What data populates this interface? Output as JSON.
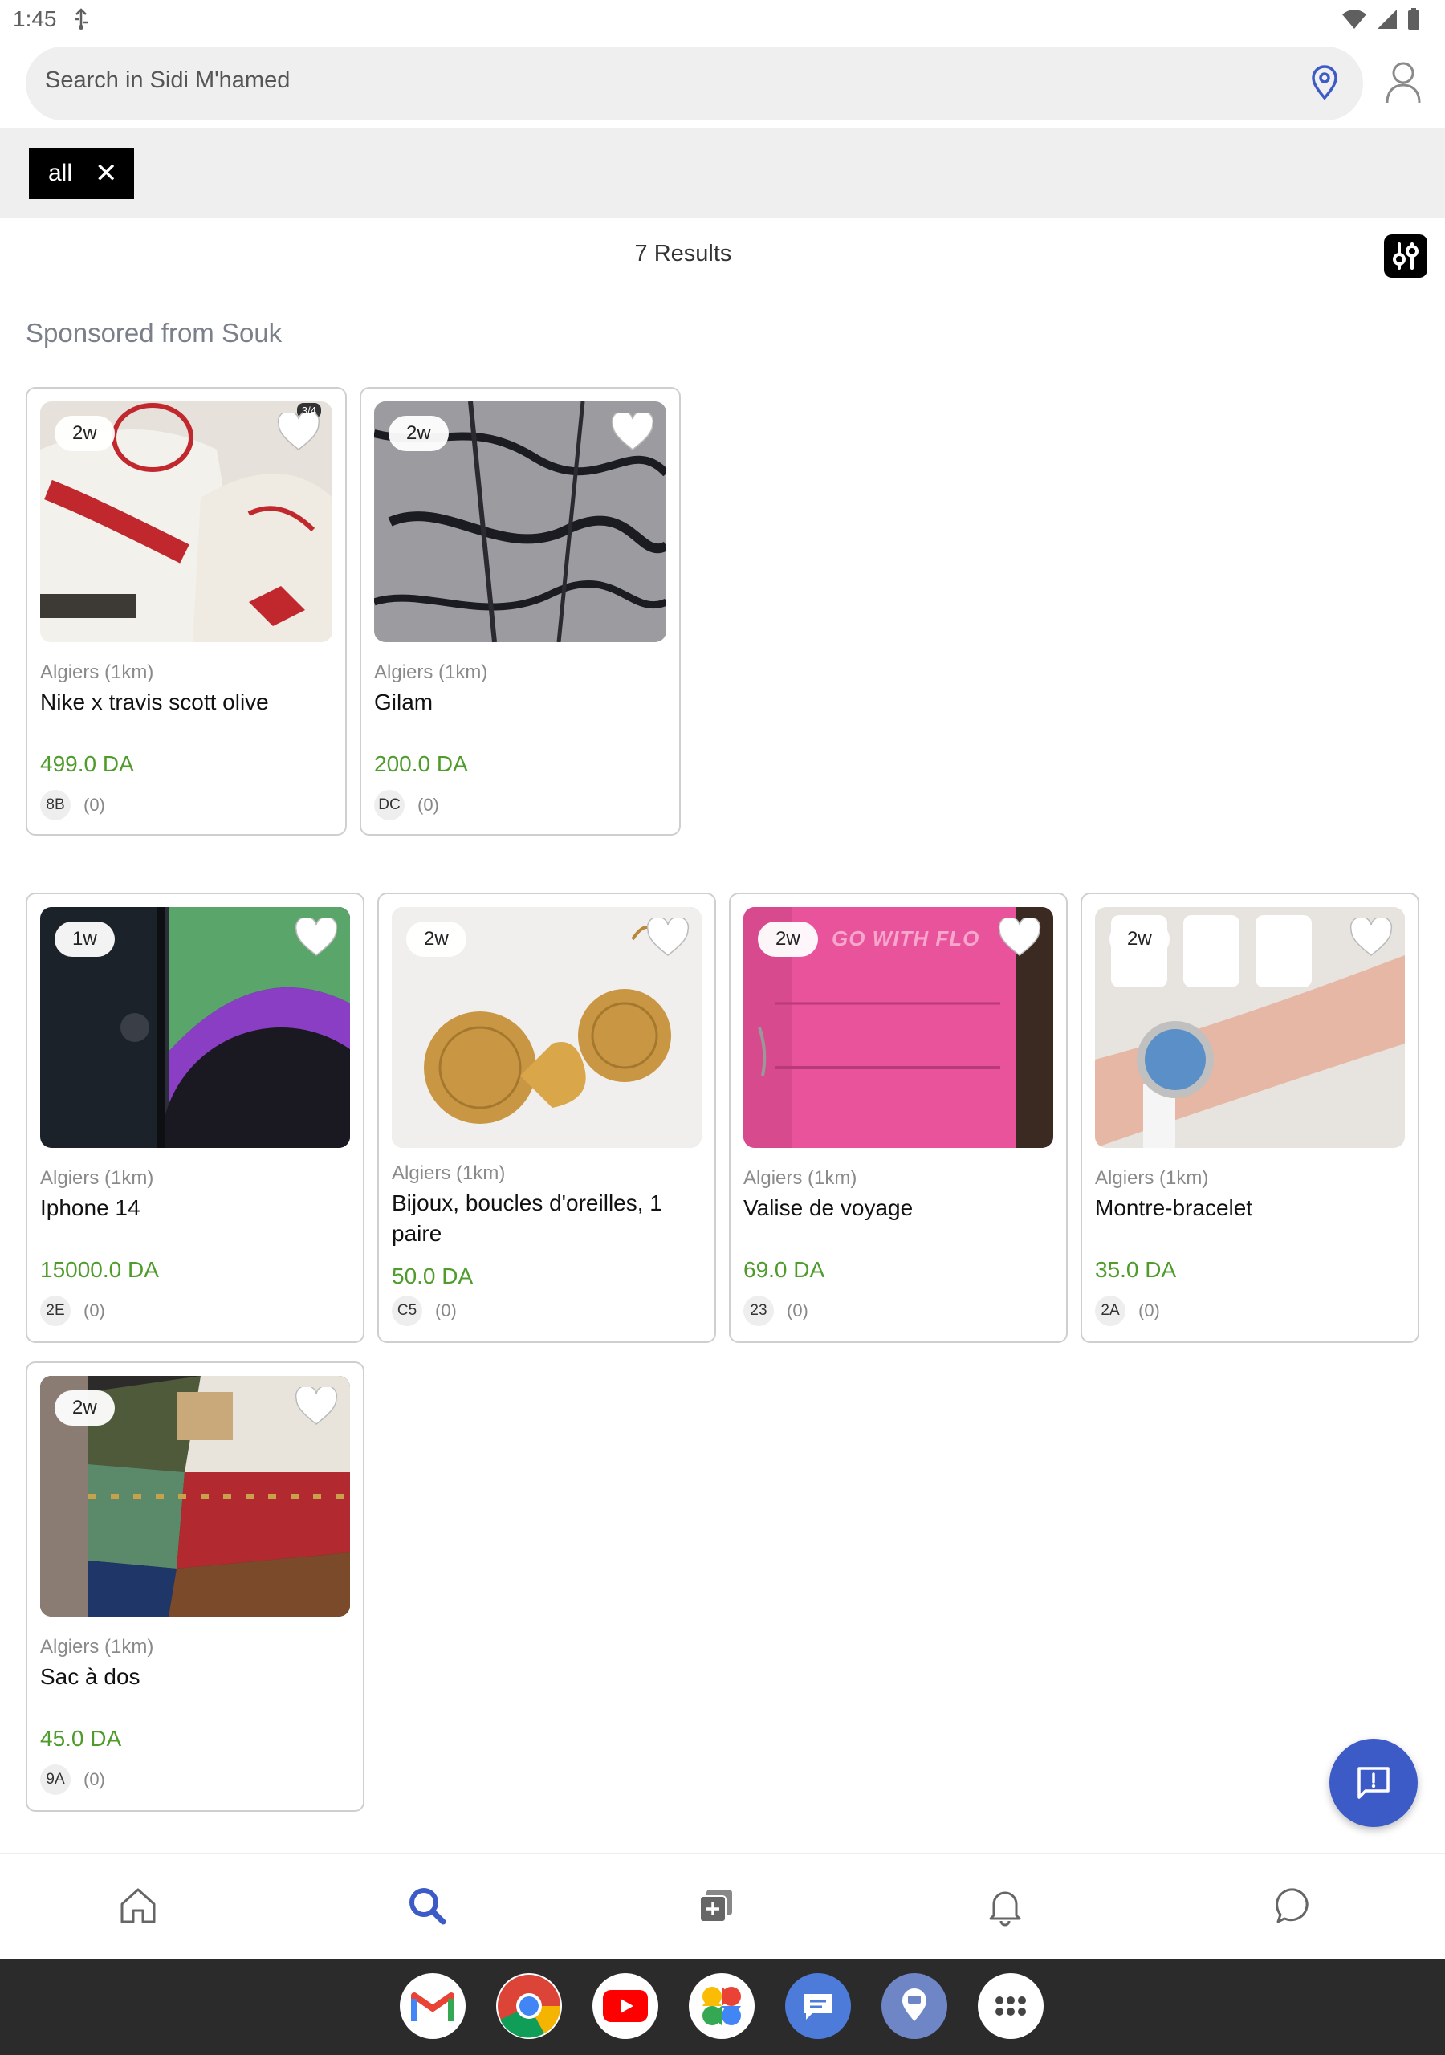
{
  "status_bar": {
    "time": "1:45"
  },
  "search": {
    "placeholder": "Search in Sidi M'hamed"
  },
  "filters": {
    "chips": [
      {
        "label": "all"
      }
    ]
  },
  "results": {
    "count_label": "7 Results"
  },
  "sponsored": {
    "title": "Sponsored from Souk",
    "listings": [
      {
        "age": "2w",
        "location": "Algiers (1km)",
        "title": "Nike x travis scott olive",
        "price": "499.0 DA",
        "seller": "8B",
        "reviews": "(0)",
        "image_badge": "3/4"
      },
      {
        "age": "2w",
        "location": "Algiers (1km)",
        "title": "Gilam",
        "price": "200.0 DA",
        "seller": "DC",
        "reviews": "(0)"
      }
    ]
  },
  "listings": [
    {
      "age": "1w",
      "location": "Algiers (1km)",
      "title": "Iphone 14",
      "price": "15000.0 DA",
      "seller": "2E",
      "reviews": "(0)"
    },
    {
      "age": "2w",
      "location": "Algiers (1km)",
      "title": "Bijoux, boucles d'oreilles, 1 paire",
      "price": "50.0 DA",
      "seller": "C5",
      "reviews": "(0)"
    },
    {
      "age": "2w",
      "location": "Algiers (1km)",
      "title": "Valise de voyage",
      "price": "69.0 DA",
      "seller": "23",
      "reviews": "(0)",
      "image_text": "GO WITH FLO"
    },
    {
      "age": "2w",
      "location": "Algiers (1km)",
      "title": "Montre-bracelet",
      "price": "35.0 DA",
      "seller": "2A",
      "reviews": "(0)"
    },
    {
      "age": "2w",
      "location": "Algiers (1km)",
      "title": "Sac à dos",
      "price": "45.0 DA",
      "seller": "9A",
      "reviews": "(0)"
    }
  ],
  "bottom_nav": {
    "items": [
      {
        "icon": "home-icon",
        "active": false
      },
      {
        "icon": "search-icon",
        "active": true
      },
      {
        "icon": "add-listing-icon",
        "active": false
      },
      {
        "icon": "bell-icon",
        "active": false
      },
      {
        "icon": "chat-icon",
        "active": false
      }
    ]
  },
  "dock": {
    "apps": [
      {
        "icon": "gmail-icon"
      },
      {
        "icon": "chrome-icon"
      },
      {
        "icon": "youtube-icon"
      },
      {
        "icon": "photos-icon"
      },
      {
        "icon": "messages-icon"
      },
      {
        "icon": "maps-app-icon"
      },
      {
        "icon": "app-drawer-icon"
      }
    ]
  },
  "colors": {
    "price": "#4f9c2c",
    "accent": "#3d5bc7",
    "chip_bg": "#000000"
  }
}
